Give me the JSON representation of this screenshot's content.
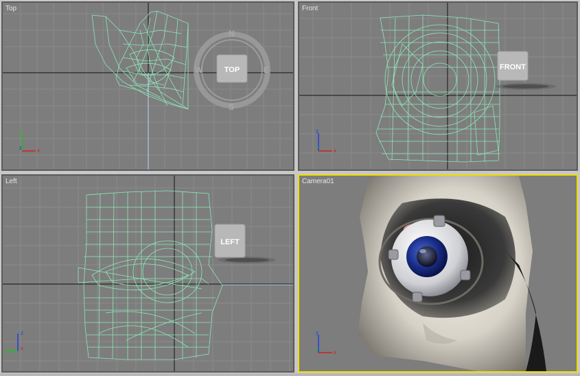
{
  "viewports": {
    "top": {
      "label": "Top",
      "cube_label": "TOP",
      "compass": [
        "N",
        "E",
        "S",
        "W"
      ]
    },
    "front": {
      "label": "Front",
      "cube_label": "FRONT"
    },
    "left": {
      "label": "Left",
      "cube_label": "LEFT"
    },
    "camera": {
      "label": "Camera01"
    }
  },
  "axis_labels": {
    "x": "x",
    "y": "y",
    "z": "z"
  },
  "colors": {
    "viewport_bg": "#7d7d7d",
    "grid_line": "#8a8a8a",
    "home_grid": "#111111",
    "wireframe": "#8ee8b8",
    "active_border": "#f0dc00",
    "axis_x": "#d02020",
    "axis_y": "#20c020",
    "axis_z": "#2040e0"
  },
  "icons": {
    "view_cube": "view-cube-icon",
    "compass": "compass-ring-icon",
    "axis_tripod": "axis-tripod-icon"
  }
}
